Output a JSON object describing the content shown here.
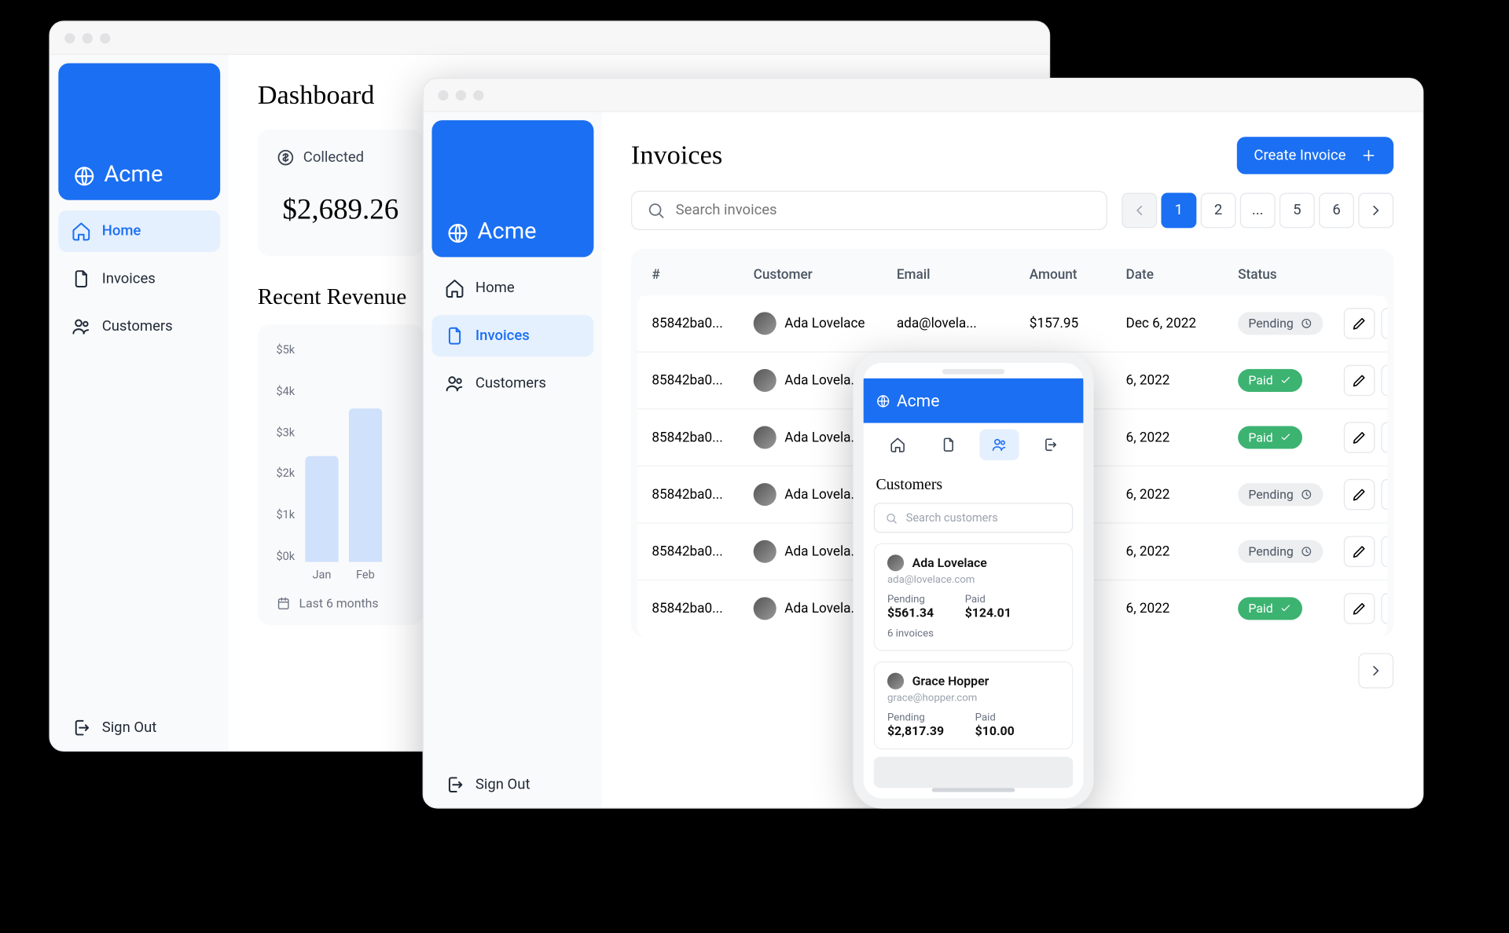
{
  "brand": "Acme",
  "sidebar": {
    "home": "Home",
    "invoices": "Invoices",
    "customers": "Customers",
    "signout": "Sign Out"
  },
  "dashboard": {
    "title": "Dashboard",
    "collected_label": "Collected",
    "collected_value": "$2,689.26",
    "revenue_title": "Recent Revenue",
    "chart_footer": "Last 6 months"
  },
  "chart_data": {
    "type": "bar",
    "categories": [
      "Jan",
      "Feb"
    ],
    "values": [
      2400,
      3500
    ],
    "y_ticks": [
      "$5k",
      "$4k",
      "$3k",
      "$2k",
      "$1k",
      "$0k"
    ],
    "ylim": [
      0,
      5000
    ],
    "title": "Recent Revenue"
  },
  "invoices": {
    "title": "Invoices",
    "create_label": "Create Invoice",
    "search_placeholder": "Search invoices",
    "pages": [
      "1",
      "2",
      "...",
      "5",
      "6"
    ],
    "columns": {
      "id": "#",
      "customer": "Customer",
      "email": "Email",
      "amount": "Amount",
      "date": "Date",
      "status": "Status"
    },
    "rows": [
      {
        "id": "85842ba0...",
        "customer": "Ada Lovelace",
        "email": "ada@lovela...",
        "amount": "$157.95",
        "date": "Dec 6, 2022",
        "status": "Pending"
      },
      {
        "id": "85842ba0...",
        "customer": "Ada Lovela...",
        "email": "",
        "amount": "",
        "date": "6, 2022",
        "status": "Paid"
      },
      {
        "id": "85842ba0...",
        "customer": "Ada Lovela...",
        "email": "",
        "amount": "",
        "date": "6, 2022",
        "status": "Paid"
      },
      {
        "id": "85842ba0...",
        "customer": "Ada Lovela...",
        "email": "",
        "amount": "",
        "date": "6, 2022",
        "status": "Pending"
      },
      {
        "id": "85842ba0...",
        "customer": "Ada Lovela...",
        "email": "",
        "amount": "",
        "date": "6, 2022",
        "status": "Pending"
      },
      {
        "id": "85842ba0...",
        "customer": "Ada Lovela...",
        "email": "",
        "amount": "",
        "date": "6, 2022",
        "status": "Paid"
      }
    ]
  },
  "mobile": {
    "title": "Customers",
    "search_placeholder": "Search customers",
    "cards": [
      {
        "name": "Ada Lovelace",
        "email": "ada@lovelace.com",
        "pending_label": "Pending",
        "pending": "$561.34",
        "paid_label": "Paid",
        "paid": "$124.01",
        "count": "6 invoices"
      },
      {
        "name": "Grace Hopper",
        "email": "grace@hopper.com",
        "pending_label": "Pending",
        "pending": "$2,817.39",
        "paid_label": "Paid",
        "paid": "$10.00",
        "count": ""
      }
    ]
  }
}
